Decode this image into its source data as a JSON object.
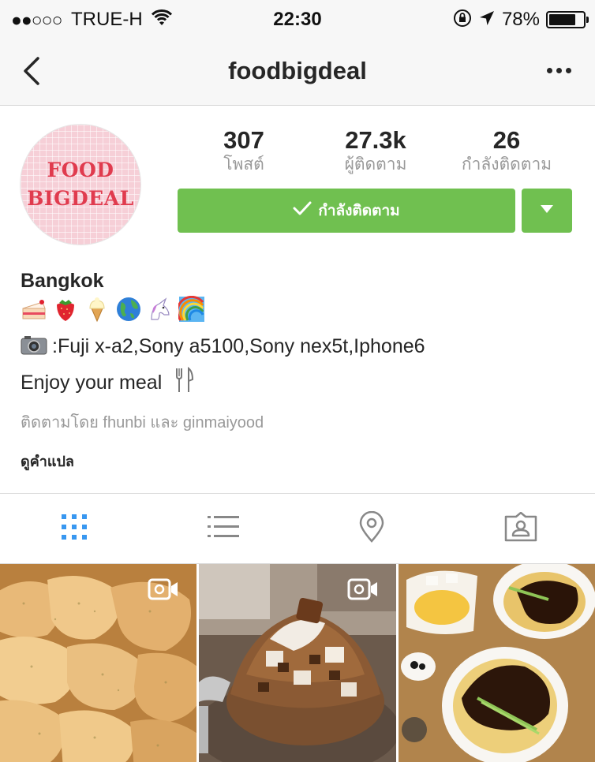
{
  "status_bar": {
    "signal": "●●○○○",
    "carrier": "TRUE-H",
    "time": "22:30",
    "battery_percent": "78%",
    "battery_level": 0.78,
    "icons": [
      "wifi-icon",
      "orientation-lock-icon",
      "location-arrow-icon",
      "battery-icon"
    ]
  },
  "nav": {
    "title": "foodbigdeal",
    "icons": [
      "back-chevron-icon",
      "more-dots-icon"
    ]
  },
  "profile": {
    "avatar_text_line1": "FOOD",
    "avatar_text_line2": "BIGDEAL",
    "stats": [
      {
        "value": "307",
        "label": "โพสต์"
      },
      {
        "value": "27.3k",
        "label": "ผู้ติดตาม"
      },
      {
        "value": "26",
        "label": "กำลังติดตาม"
      }
    ],
    "follow_button": "กำลังติดตาม"
  },
  "bio": {
    "name": "Bangkok",
    "emojis": [
      "cake-icon",
      "strawberry-icon",
      "ice-cream-icon",
      "globe-icon",
      "unicorn-icon",
      "rainbow-icon"
    ],
    "camera_line": ":Fuji x-a2,Sony a5100,Sony nex5t,Iphone6",
    "meal_line": "Enjoy your meal",
    "followed_by": "ติดตามโดย fhunbi และ ginmaiyood",
    "translate": "ดูคำแปล"
  },
  "tabs": [
    "grid-icon",
    "list-icon",
    "location-pin-icon",
    "tagged-icon"
  ],
  "colors": {
    "accent_green": "#70c050",
    "grid_tab_blue": "#3897f0",
    "avatar_pink": "#f6cfd7",
    "avatar_text_red": "#e03b4e"
  },
  "posts": [
    {
      "subject": "fried-chicken",
      "is_video": true
    },
    {
      "subject": "chocolate-bingsu",
      "is_video": true
    },
    {
      "subject": "jajangmyeon",
      "is_video": false
    }
  ]
}
